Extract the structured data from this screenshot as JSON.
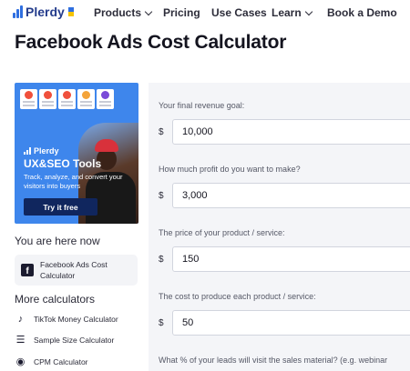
{
  "nav": {
    "brand": "Plerdy",
    "items": [
      {
        "label": "Products",
        "has_dropdown": true
      },
      {
        "label": "Pricing",
        "has_dropdown": false
      },
      {
        "label": "Use Cases",
        "has_dropdown": false
      },
      {
        "label": "Learn",
        "has_dropdown": true
      },
      {
        "label": "Book a Demo",
        "has_dropdown": false
      }
    ]
  },
  "page": {
    "title": "Facebook Ads Cost Calculator"
  },
  "banner": {
    "brand": "Plerdy",
    "headline": "UX&SEO Tools",
    "subtext": "Track, analyze, and convert your visitors into buyers",
    "cta": "Try it free"
  },
  "sidebar": {
    "you_are_here": "You are here now",
    "current": "Facebook Ads Cost Calculator",
    "more_title": "More calculators",
    "calculators": [
      {
        "label": "TikTok Money Calculator",
        "icon": "tiktok-icon"
      },
      {
        "label": "Sample Size Calculator",
        "icon": "sliders-icon"
      },
      {
        "label": "CPM Calculator",
        "icon": "globe-icon"
      }
    ]
  },
  "form": {
    "currency": "$",
    "fields": [
      {
        "question": "Your final revenue goal:",
        "value": "10,000"
      },
      {
        "question": "How much profit do you want to make?",
        "value": "3,000"
      },
      {
        "question": "The price of your product / service:",
        "value": "150"
      },
      {
        "question": "The cost to produce each product / service:",
        "value": "50"
      },
      {
        "question": "What % of your leads will visit the sales material? (e.g. webinar",
        "value": ""
      }
    ]
  },
  "colors": {
    "brand_blue": "#3e86ec",
    "brand_navy": "#10265e",
    "form_bg": "#f4f5f8"
  }
}
